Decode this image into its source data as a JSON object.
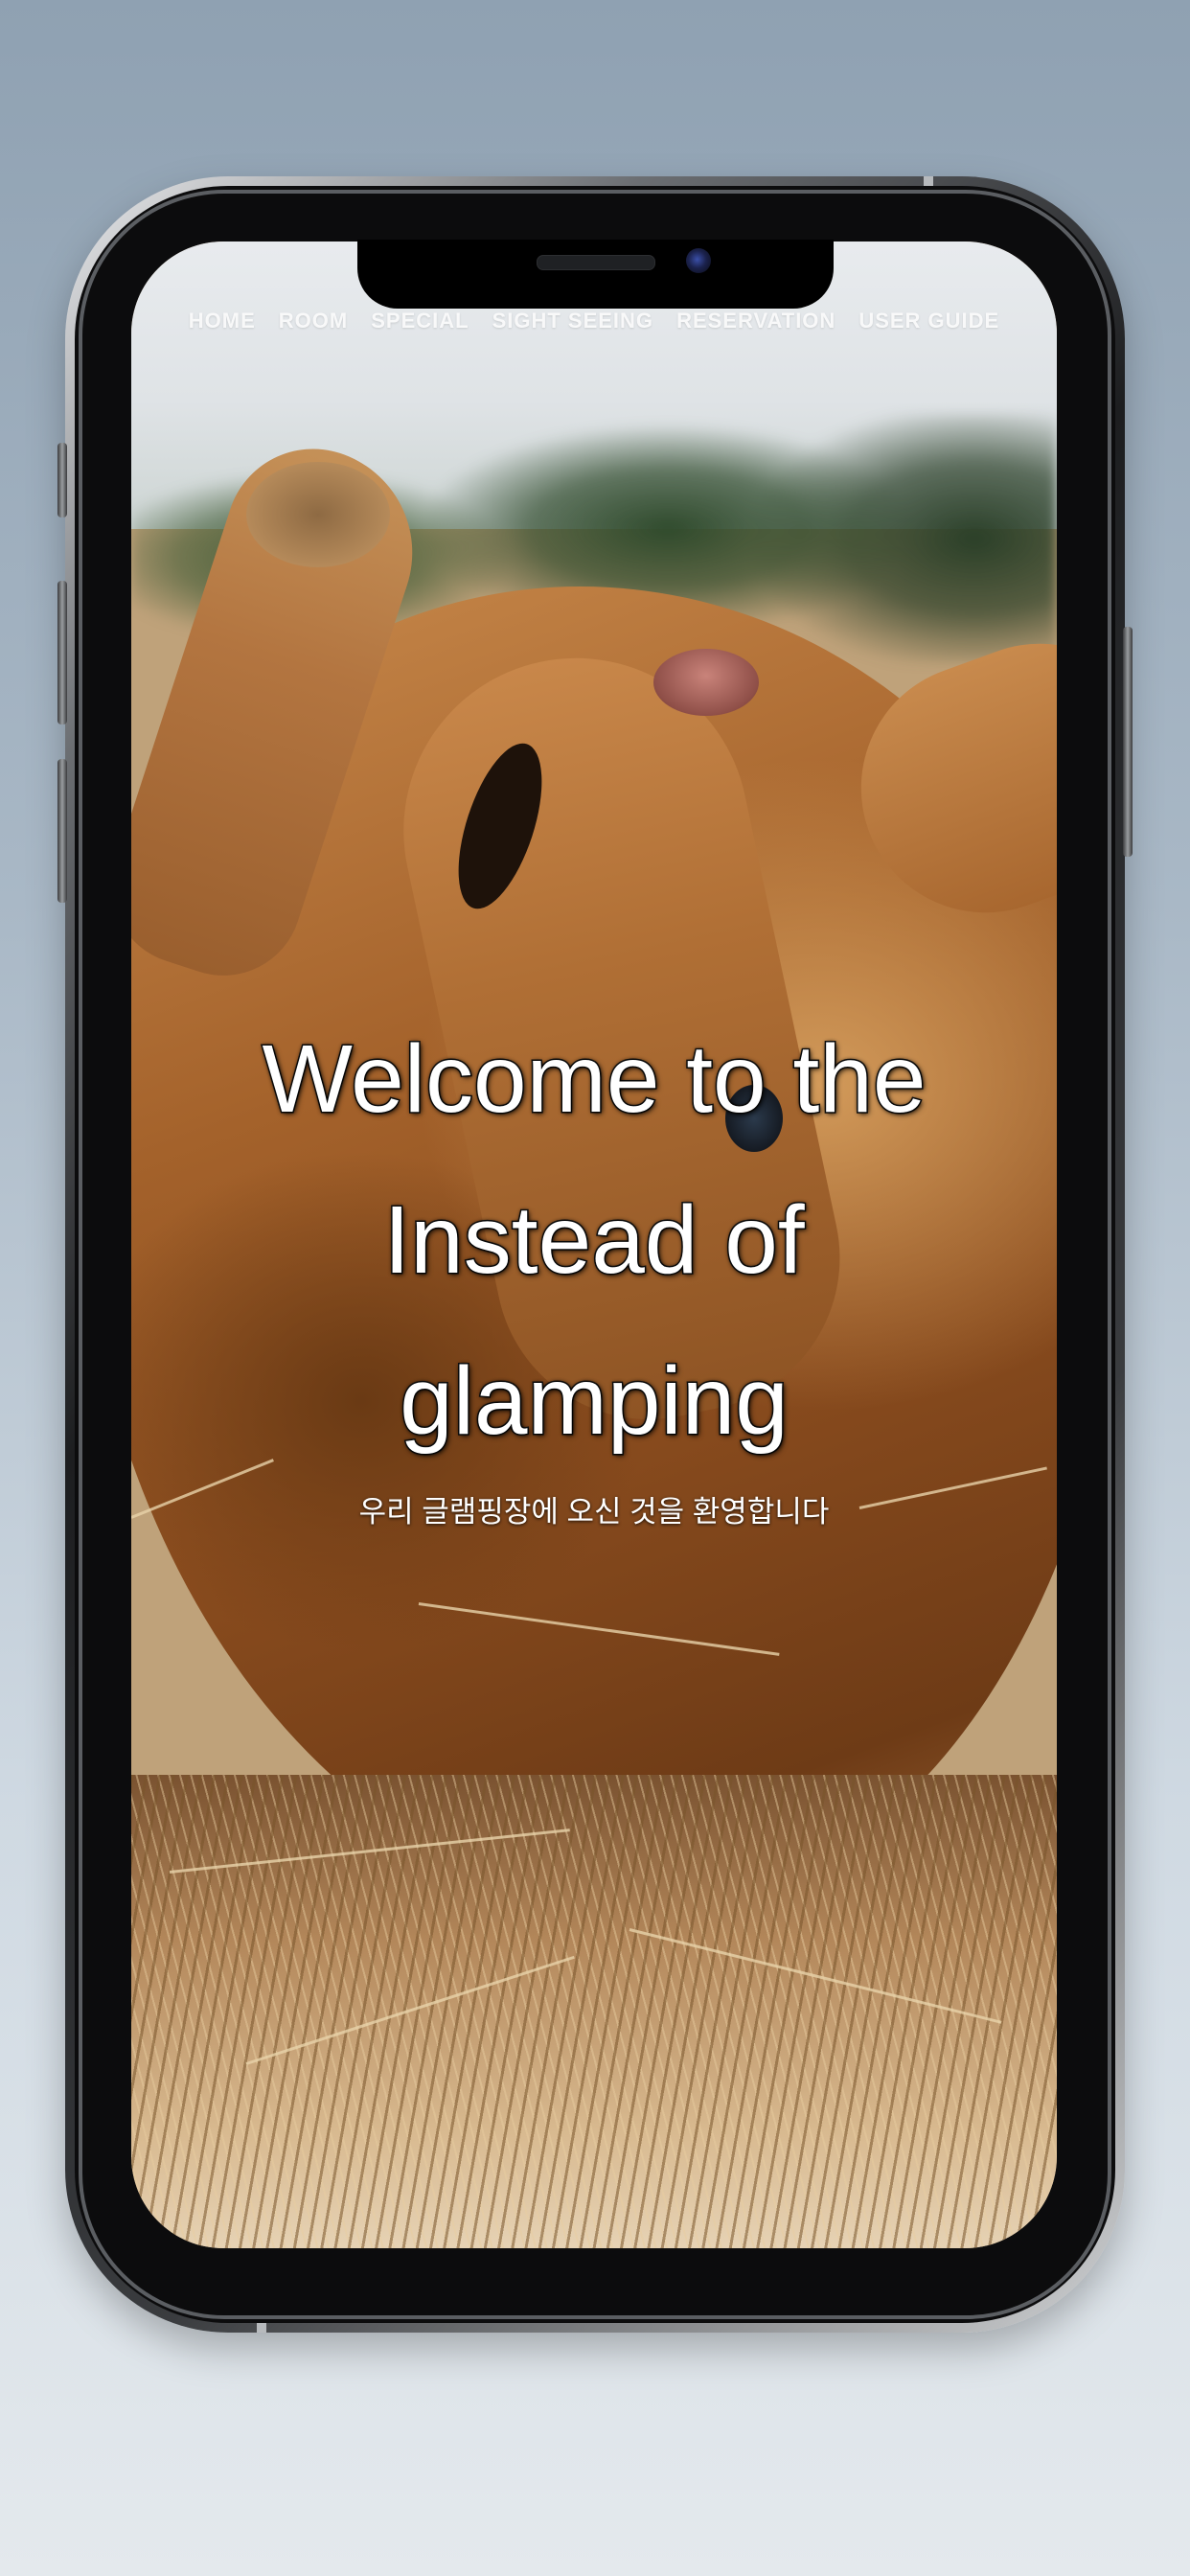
{
  "nav": {
    "items": [
      {
        "label": "HOME"
      },
      {
        "label": "ROOM"
      },
      {
        "label": "SPECIAL"
      },
      {
        "label": "SIGHT SEEING"
      },
      {
        "label": "RESERVATION"
      },
      {
        "label": "USER GUIDE"
      }
    ]
  },
  "hero": {
    "title_line1": "Welcome to the",
    "title_line2": "Instead of",
    "title_line3": "glamping",
    "subtitle": "우리 글램핑장에 오신 것을 환영합니다"
  },
  "colors": {
    "background_top": "#8fa1b2",
    "background_bottom": "#e4e9ed",
    "title_text": "#ffffff",
    "title_outline": "#111111"
  }
}
